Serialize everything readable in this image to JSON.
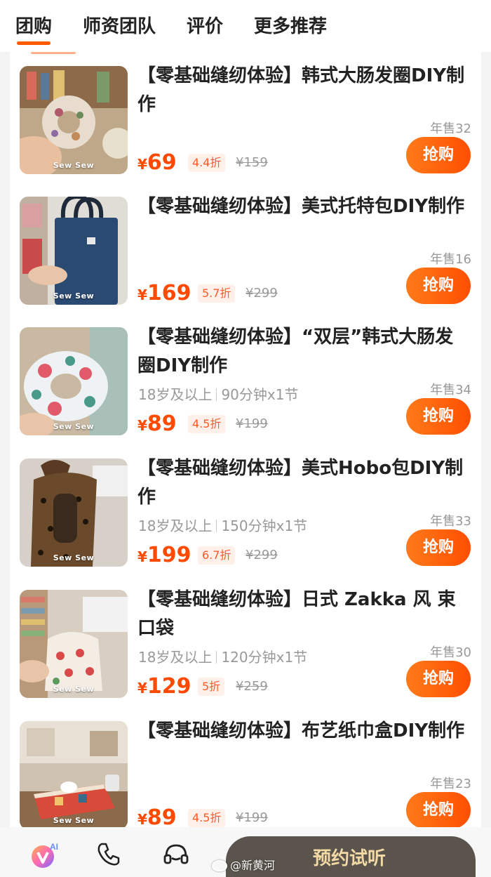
{
  "tabs": [
    {
      "label": "团购",
      "active": true
    },
    {
      "label": "师资团队",
      "active": false
    },
    {
      "label": "评价",
      "active": false
    },
    {
      "label": "更多推荐",
      "active": false
    }
  ],
  "accent_color": "#ff4f00",
  "products": [
    {
      "title": "【零基础缝纫体验】韩式大肠发圈DIY制作",
      "meta_age": "",
      "meta_duration": "",
      "sold": "年售32",
      "price_symbol": "¥",
      "price": "69",
      "discount": "4.4折",
      "original_price": "¥159",
      "buy_label": "抢购",
      "brand": "Sew Sew"
    },
    {
      "title": "【零基础缝纫体验】美式托特包DIY制作",
      "meta_age": "",
      "meta_duration": "",
      "sold": "年售16",
      "price_symbol": "¥",
      "price": "169",
      "discount": "5.7折",
      "original_price": "¥299",
      "buy_label": "抢购",
      "brand": "Sew Sew"
    },
    {
      "title": "【零基础缝纫体验】“双层”韩式大肠发圈DIY制作",
      "meta_age": "18岁及以上",
      "meta_duration": "90分钟x1节",
      "sold": "年售34",
      "price_symbol": "¥",
      "price": "89",
      "discount": "4.5折",
      "original_price": "¥199",
      "buy_label": "抢购",
      "brand": "Sew Sew"
    },
    {
      "title": "【零基础缝纫体验】美式Hobo包DIY制作",
      "meta_age": "18岁及以上",
      "meta_duration": "150分钟x1节",
      "sold": "年售33",
      "price_symbol": "¥",
      "price": "199",
      "discount": "6.7折",
      "original_price": "¥299",
      "buy_label": "抢购",
      "brand": "Sew Sew"
    },
    {
      "title": "【零基础缝纫体验】日式 Zakka 风 束口袋",
      "meta_age": "18岁及以上",
      "meta_duration": "120分钟x1节",
      "sold": "年售30",
      "price_symbol": "¥",
      "price": "129",
      "discount": "5折",
      "original_price": "¥259",
      "buy_label": "抢购",
      "brand": "Sew Sew"
    },
    {
      "title": "【零基础缝纫体验】布艺纸巾盒DIY制作",
      "meta_age": "",
      "meta_duration": "",
      "sold": "年售23",
      "price_symbol": "¥",
      "price": "89",
      "discount": "4.5折",
      "original_price": "¥199",
      "buy_label": "抢购",
      "brand": "Sew Sew"
    }
  ],
  "bottom_bar": {
    "icons": [
      "ai-assistant-icon",
      "phone-icon",
      "headset-icon"
    ],
    "reserve_label": "预约试听"
  },
  "watermark": "@新黄河"
}
